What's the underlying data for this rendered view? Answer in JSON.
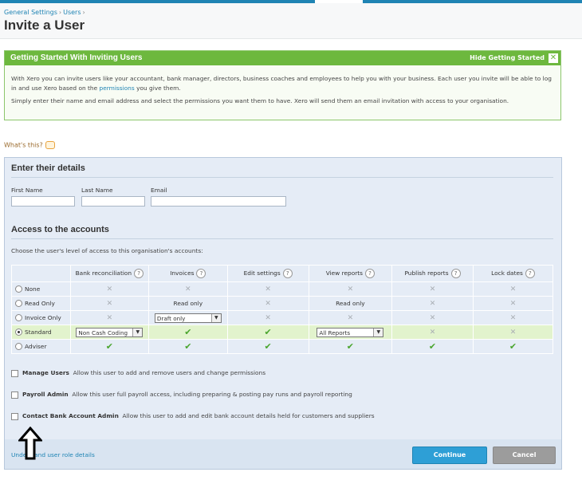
{
  "breadcrumb": [
    "General Settings",
    "Users"
  ],
  "page_title": "Invite a User",
  "getting_started": {
    "title": "Getting Started With Inviting Users",
    "hide_label": "Hide Getting Started",
    "close_glyph": "✕",
    "para1_a": "With Xero you can invite users like your accountant, bank manager, directors, business coaches and employees to help you with your business. Each user you invite will be able to log in and use Xero based on the ",
    "para1_link": "permissions",
    "para1_b": " you give them.",
    "para2": "Simply enter their name and email address and select the permissions you want them to have. Xero will send them an email invitation with access to your organisation."
  },
  "whats_this": "What's this?",
  "details": {
    "title": "Enter their details",
    "first_name_label": "First Name",
    "last_name_label": "Last Name",
    "email_label": "Email"
  },
  "access": {
    "title": "Access to the accounts",
    "description": "Choose the user's level of access to this organisation's accounts:",
    "columns": [
      "Bank reconciliation",
      "Invoices",
      "Edit settings",
      "View reports",
      "Publish reports",
      "Lock dates"
    ],
    "help_glyph": "?",
    "rows": [
      {
        "label": "None",
        "selected": false,
        "cells": [
          "x",
          "x",
          "x",
          "x",
          "x",
          "x"
        ]
      },
      {
        "label": "Read Only",
        "selected": false,
        "cells": [
          "x",
          "Read only",
          "x",
          "Read only",
          "x",
          "x"
        ]
      },
      {
        "label": "Invoice Only",
        "selected": false,
        "cells": [
          "x",
          "select:Draft only",
          "x",
          "x",
          "x",
          "x"
        ]
      },
      {
        "label": "Standard",
        "selected": true,
        "cells": [
          "select:Non Cash Coding",
          "check",
          "check",
          "select:All Reports",
          "x",
          "x"
        ]
      },
      {
        "label": "Adviser",
        "selected": false,
        "cells": [
          "check",
          "check",
          "check",
          "check",
          "check",
          "check"
        ]
      }
    ]
  },
  "permissions": [
    {
      "title": "Manage Users",
      "desc": "Allow this user to add and remove users and change permissions"
    },
    {
      "title": "Payroll Admin",
      "desc": "Allow this user full payroll access, including preparing & posting pay runs and payroll reporting"
    },
    {
      "title": "Contact Bank Account Admin",
      "desc": "Allow this user to add and edit bank account details held for customers and suppliers"
    }
  ],
  "footer": {
    "understand_link": "Understand user role details",
    "continue_label": "Continue",
    "cancel_label": "Cancel"
  },
  "colors": {
    "accent": "#1f84b4",
    "green": "#6db83e",
    "check": "#4aa52e"
  }
}
